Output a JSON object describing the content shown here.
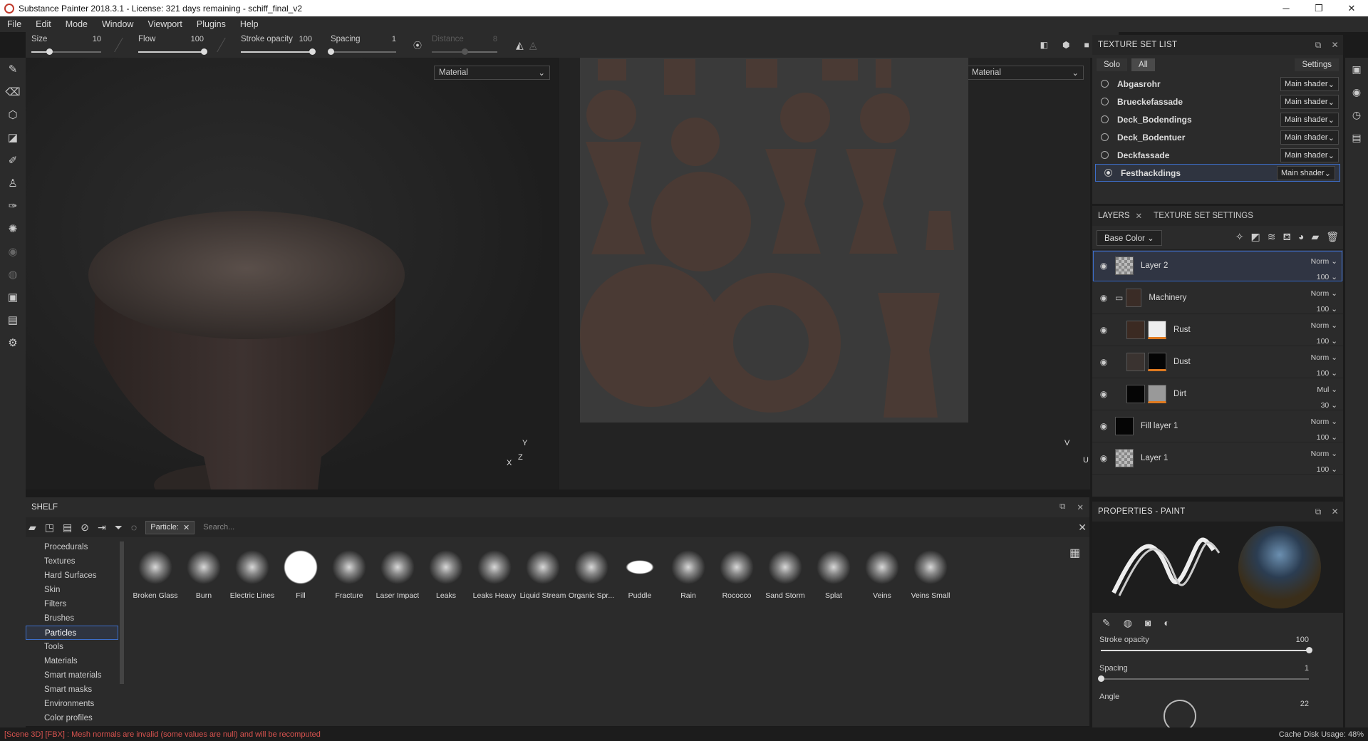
{
  "window": {
    "title": "Substance Painter 2018.3.1 - License: 321 days remaining - schiff_final_v2",
    "min": "─",
    "max": "❐",
    "close": "✕"
  },
  "menu": [
    "File",
    "Edit",
    "Mode",
    "Window",
    "Viewport",
    "Plugins",
    "Help"
  ],
  "toolbar": {
    "size": {
      "label": "Size",
      "value": "10",
      "fraction": 0.25
    },
    "flow": {
      "label": "Flow",
      "value": "100",
      "fraction": 1.0
    },
    "stroke_opacity": {
      "label": "Stroke opacity",
      "value": "100",
      "fraction": 1.0
    },
    "spacing": {
      "label": "Spacing",
      "value": "1",
      "fraction": 0.0
    },
    "distance": {
      "label": "Distance",
      "value": "8",
      "fraction": 0.5
    }
  },
  "viewport": {
    "left_mode": "Material",
    "right_mode": "Material",
    "axis3d": {
      "y": "Y",
      "z": "Z",
      "x": "X"
    },
    "axis2d": {
      "v": "V",
      "u": "U"
    }
  },
  "texture_set_list": {
    "title": "TEXTURE SET LIST",
    "solo": "Solo",
    "all": "All",
    "settings": "Settings",
    "items": [
      {
        "name": "Abgasrohr",
        "shader": "Main shader"
      },
      {
        "name": "Brueckefassade",
        "shader": "Main shader"
      },
      {
        "name": "Deck_Bodendings",
        "shader": "Main shader"
      },
      {
        "name": "Deck_Bodentuer",
        "shader": "Main shader"
      },
      {
        "name": "Deckfassade",
        "shader": "Main shader"
      },
      {
        "name": "Festhackdings",
        "shader": "Main shader"
      }
    ]
  },
  "layers": {
    "tab_layers": "LAYERS",
    "tab_tss": "TEXTURE SET SETTINGS",
    "channel": "Base Color",
    "items": [
      {
        "name": "Layer 2",
        "blend": "Norm",
        "opacity": "100"
      },
      {
        "name": "Machinery",
        "blend": "Norm",
        "opacity": "100"
      },
      {
        "name": "Rust",
        "blend": "Norm",
        "opacity": "100"
      },
      {
        "name": "Dust",
        "blend": "Norm",
        "opacity": "100"
      },
      {
        "name": "Dirt",
        "blend": "Mul",
        "opacity": "30"
      },
      {
        "name": "Fill layer 1",
        "blend": "Norm",
        "opacity": "100"
      },
      {
        "name": "Layer 1",
        "blend": "Norm",
        "opacity": "100"
      }
    ]
  },
  "shelf": {
    "title": "SHELF",
    "filter_chip": "Particle:",
    "search_placeholder": "Search...",
    "categories": [
      "Procedurals",
      "Textures",
      "Hard Surfaces",
      "Skin",
      "Filters",
      "Brushes",
      "Particles",
      "Tools",
      "Materials",
      "Smart materials",
      "Smart masks",
      "Environments",
      "Color profiles"
    ],
    "items": [
      "Broken Glass",
      "Burn",
      "Electric Lines",
      "Fill",
      "Fracture",
      "Laser Impact",
      "Leaks",
      "Leaks Heavy",
      "Liquid Stream",
      "Organic Spr...",
      "Puddle",
      "Rain",
      "Rococco",
      "Sand Storm",
      "Splat",
      "Veins",
      "Veins Small"
    ]
  },
  "properties": {
    "title": "PROPERTIES - PAINT",
    "stroke_opacity": {
      "label": "Stroke opacity",
      "value": "100",
      "fraction": 1.0
    },
    "spacing": {
      "label": "Spacing",
      "value": "1",
      "fraction": 0.0
    },
    "angle": {
      "label": "Angle",
      "value": "22"
    }
  },
  "status": {
    "error": "[Scene 3D] [FBX] : Mesh normals are invalid (some values are null) and will be recomputed",
    "cache": "Cache Disk Usage:   48%"
  }
}
